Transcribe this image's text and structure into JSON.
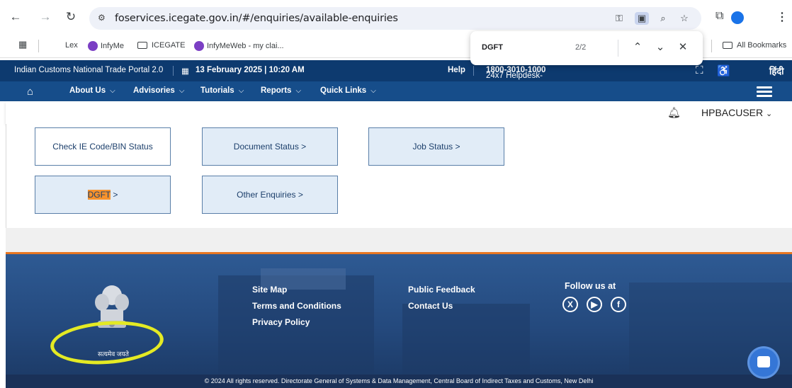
{
  "browser": {
    "url": "foservices.icegate.gov.in/#/enquiries/available-enquiries",
    "bookmarks": [
      "Lex",
      "InfyMe",
      "ICEGATE",
      "InfyMeWeb - my clai..."
    ],
    "all_bookmarks": "All Bookmarks"
  },
  "findbar": {
    "query": "DGFT",
    "count": "2/2"
  },
  "header": {
    "portal_name": "Indian Customs National Trade Portal 2.0",
    "datetime": "13 February 2025 | 10:20 AM",
    "help": "Help",
    "helpdesk_prefix": "24x7 Helpdesk-",
    "helpdesk_number": "1800-3010-1000",
    "hindi": "हिंदी"
  },
  "menu": {
    "items": [
      "About Us",
      "Advisories",
      "Tutorials",
      "Reports",
      "Quick Links"
    ]
  },
  "user": {
    "name": "HPBACUSER"
  },
  "enquiries": {
    "check_ie": "Check IE Code/BIN Status",
    "document_status": "Document Status >",
    "job_status": "Job Status >",
    "dgft_highlight": "DGFT",
    "dgft_suffix": " >",
    "other_enquiries": "Other Enquiries >"
  },
  "footer": {
    "links_col1": [
      "Site Map",
      "Terms and Conditions",
      "Privacy Policy"
    ],
    "links_col2": [
      "Public Feedback",
      "Contact Us"
    ],
    "follow_us": "Follow us at",
    "motto": "सत्यमेव जयते",
    "copyright": "© 2024 All rights reserved. Directorate General of Systems & Data Management, Central Board of Indirect Taxes and Customs, New Delhi"
  },
  "colors": {
    "topbar": "#0d3a6f",
    "menubar": "#164d8a",
    "accent_orange": "#e87722",
    "highlight_ring": "#e4ea24"
  }
}
